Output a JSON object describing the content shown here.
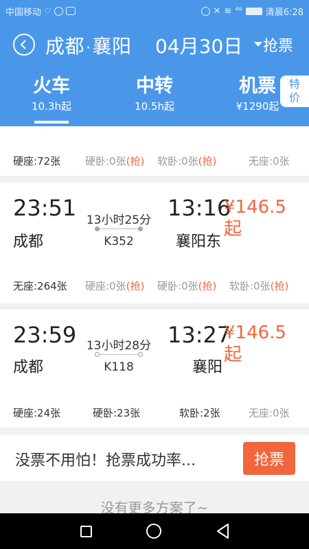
{
  "status_bar": {
    "carrier": "中国移动",
    "time": "清晨6:28",
    "signal_text": "⁴⁶"
  },
  "header": {
    "from": "成都",
    "separator": "·",
    "to": "襄阳",
    "date": "04月30日",
    "grab_label": "抢票"
  },
  "tabs": [
    {
      "label": "火车",
      "sub": "10.3h起"
    },
    {
      "label": "中转",
      "sub": "10.5h起"
    },
    {
      "label": "机票",
      "sub": "¥1290起"
    }
  ],
  "badge": {
    "line1": "特",
    "line2": "价"
  },
  "top_seats": {
    "s1": "硬座:72张",
    "s2_text": "硬卧:0张",
    "s2_grab": "(抢)",
    "s3_text": "软卧:0张",
    "s3_grab": "(抢)",
    "s4": "无座:0张"
  },
  "trains": [
    {
      "dep_time": "23:51",
      "dep_station": "成都",
      "duration": "13小时25分",
      "train_no": "K352",
      "arr_time": "13:16",
      "arr_station": "襄阳东",
      "price": "¥146.5",
      "price_suffix": "起",
      "seats": {
        "s1": "无座:264张",
        "s2_text": "硬座:0张",
        "s2_grab": "(抢)",
        "s3_text": "硬卧:0张",
        "s3_grab": "(抢)",
        "s4_text": "软卧:0张",
        "s4_grab": "(抢)"
      }
    },
    {
      "dep_time": "23:59",
      "dep_station": "成都",
      "duration": "13小时28分",
      "train_no": "K118",
      "arr_time": "13:27",
      "arr_station": "襄阳",
      "price": "¥146.5",
      "price_suffix": "起",
      "seats": {
        "s1": "硬座:24张",
        "s2": "硬卧:23张",
        "s3": "软卧:2张",
        "s4": "无座:0张"
      }
    }
  ],
  "banner": {
    "text": "没票不用怕！抢票成功率...",
    "button": "抢票"
  },
  "footer": {
    "no_more": "没有更多方案了~"
  },
  "colors": {
    "primary": "#4a97ea",
    "accent": "#f2663d",
    "muted": "#999999"
  }
}
